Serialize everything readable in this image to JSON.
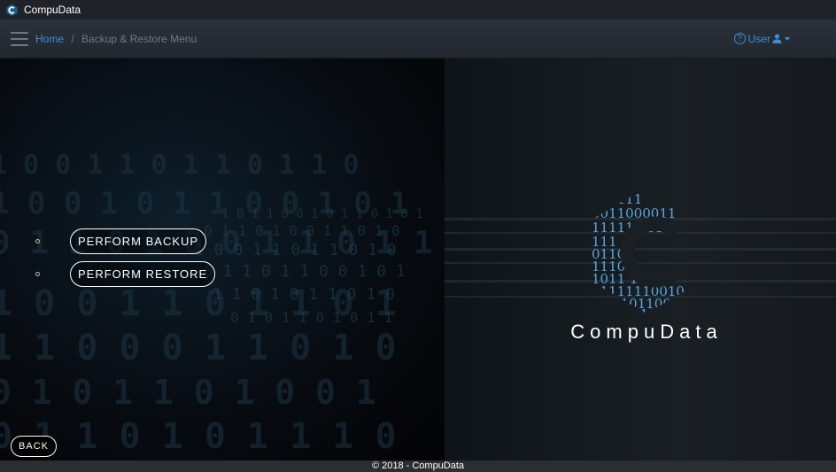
{
  "titlebar": {
    "app_title": "CompuData",
    "logo_icon": "compudata-logo-icon"
  },
  "navbar": {
    "breadcrumb": {
      "home": "Home",
      "separator": "/",
      "current": "Backup & Restore Menu"
    },
    "user_menu": {
      "help_icon": "?",
      "label": "User",
      "icon": "user-icon"
    }
  },
  "menu": {
    "items": [
      {
        "label": "PERFORM BACKUP"
      },
      {
        "label": "PERFORM RESTORE"
      }
    ],
    "back_label": "BACK"
  },
  "brand": {
    "name": "CompuData",
    "logo_binary": [
      "110111",
      "0011000011",
      "11111  1110",
      "111",
      "0110",
      "1110",
      "1011  101",
      "01111110010",
      "100101100",
      "0111"
    ]
  },
  "footer": {
    "copyright": "© 2018 - CompuData"
  },
  "colors": {
    "accent": "#3a8fd8",
    "navbar": "#2b3138",
    "footer": "#2a2d31",
    "muted": "#6f7882"
  }
}
